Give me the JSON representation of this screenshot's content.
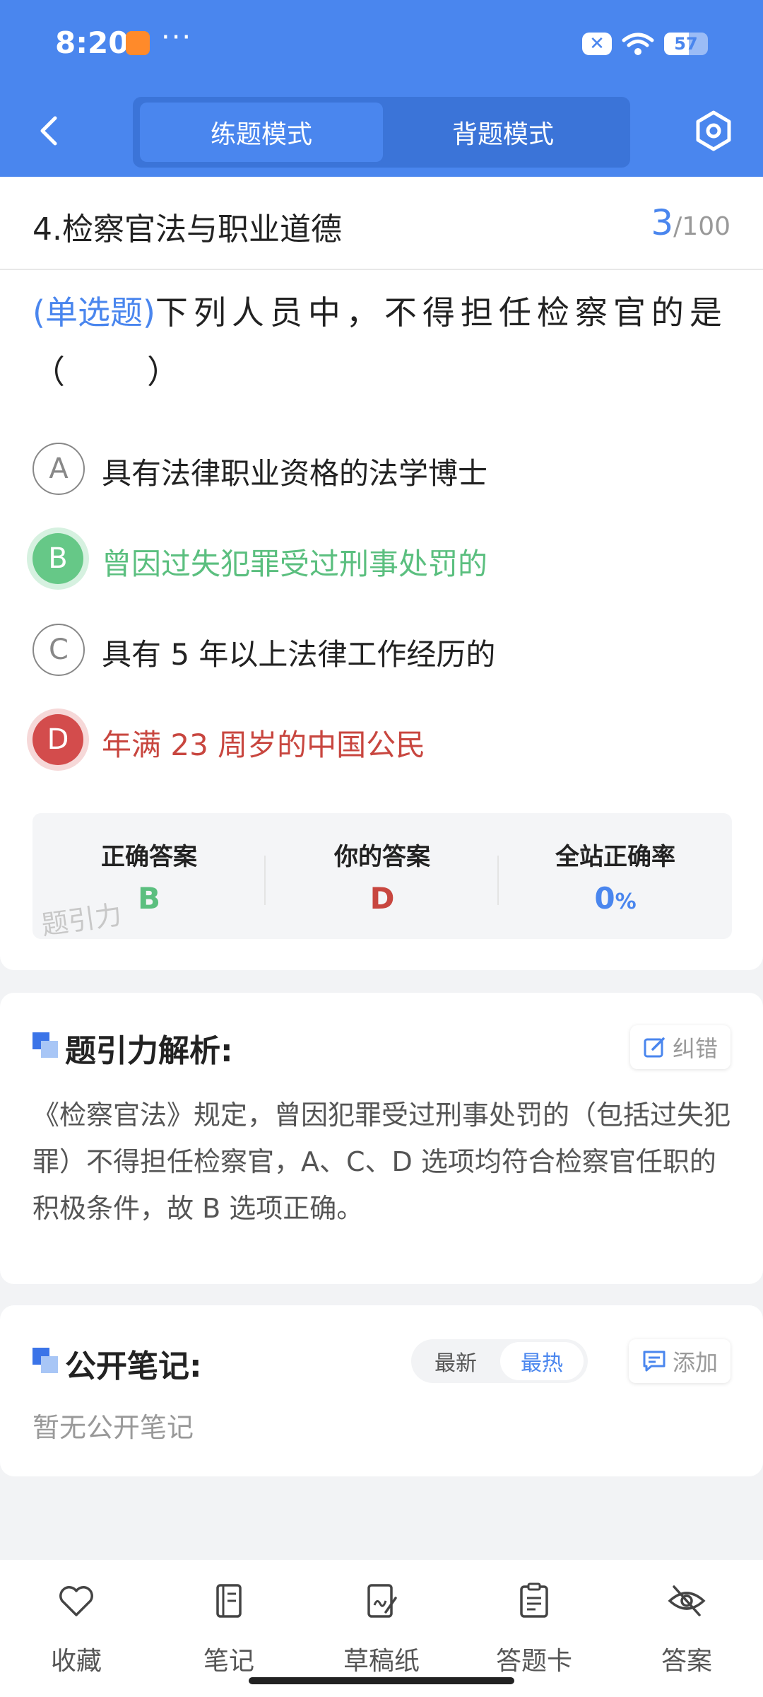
{
  "status_bar": {
    "time": "8:20",
    "dots": "···",
    "battery": "57",
    "battery_level": 0.57
  },
  "nav": {
    "modes": [
      {
        "label": "练题模式",
        "active": true
      },
      {
        "label": "背题模式",
        "active": false
      }
    ]
  },
  "question": {
    "section_title": "4.检察官法与职业道德",
    "current": "3",
    "total": "/100",
    "type": "(单选题)",
    "text": "下列人员中，不得担任检察官的是（　　）",
    "options": [
      {
        "letter": "A",
        "text": "具有法律职业资格的法学博士",
        "state": "normal"
      },
      {
        "letter": "B",
        "text": "曾因过失犯罪受过刑事处罚的",
        "state": "correct"
      },
      {
        "letter": "C",
        "text": "具有 5 年以上法律工作经历的",
        "state": "normal"
      },
      {
        "letter": "D",
        "text": "年满 23 周岁的中国公民",
        "state": "wrong"
      }
    ]
  },
  "answers": {
    "correct_label": "正确答案",
    "correct_value": "B",
    "yours_label": "你的答案",
    "yours_value": "D",
    "rate_label": "全站正确率",
    "rate_value": "0",
    "rate_unit": "%",
    "watermark": "题引力"
  },
  "analysis": {
    "heading": "题引力解析:",
    "correct_button": "纠错",
    "text": "《检察官法》规定，曾因犯罪受过刑事处罚的（包括过失犯罪）不得担任检察官，A、C、D 选项均符合检察官任职的积极条件，故 B 选项正确。"
  },
  "notes": {
    "heading": "公开笔记:",
    "sort_latest": "最新",
    "sort_hot": "最热",
    "add_button": "添加",
    "empty": "暂无公开笔记"
  },
  "toolbar": [
    {
      "label": "收藏",
      "icon": "heart-icon"
    },
    {
      "label": "笔记",
      "icon": "notebook-icon"
    },
    {
      "label": "草稿纸",
      "icon": "draft-paper-icon"
    },
    {
      "label": "答题卡",
      "icon": "answer-card-icon"
    },
    {
      "label": "答案",
      "icon": "eye-off-icon"
    }
  ],
  "colors": {
    "primary": "#4a86ee",
    "correct": "#66c887",
    "wrong": "#d34c4c"
  }
}
